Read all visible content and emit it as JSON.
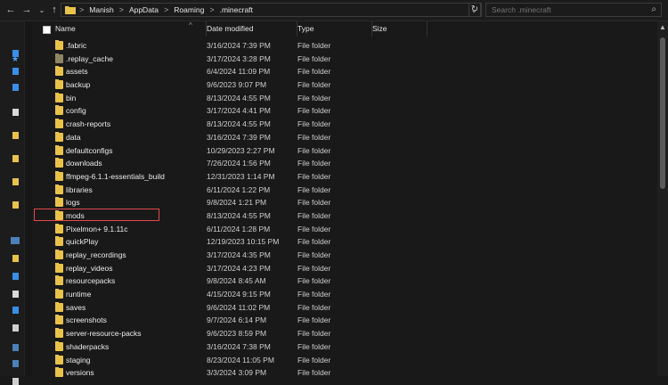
{
  "toolbar": {
    "back_icon": "back-arrow-icon",
    "forward_icon": "forward-arrow-icon",
    "recent_icon": "chevron-down-icon",
    "up_icon": "up-arrow-icon",
    "refresh_icon": "refresh-icon"
  },
  "address_bar": {
    "crumbs": [
      "Manish",
      "AppData",
      "Roaming",
      ".minecraft"
    ],
    "separator": ">"
  },
  "search": {
    "placeholder": "Search .minecraft"
  },
  "columns": {
    "name": "Name",
    "date_modified": "Date modified",
    "type": "Type",
    "size": "Size"
  },
  "files": [
    {
      "name": ".fabric",
      "date": "3/16/2024 7:39 PM",
      "type": "File folder",
      "dim": false
    },
    {
      "name": ".replay_cache",
      "date": "3/17/2024 3:28 PM",
      "type": "File folder",
      "dim": true
    },
    {
      "name": "assets",
      "date": "6/4/2024 11:09 PM",
      "type": "File folder",
      "dim": false
    },
    {
      "name": "backup",
      "date": "9/6/2023 9:07 PM",
      "type": "File folder",
      "dim": false
    },
    {
      "name": "bin",
      "date": "8/13/2024 4:55 PM",
      "type": "File folder",
      "dim": false
    },
    {
      "name": "config",
      "date": "3/17/2024 4:41 PM",
      "type": "File folder",
      "dim": false
    },
    {
      "name": "crash-reports",
      "date": "8/13/2024 4:55 PM",
      "type": "File folder",
      "dim": false
    },
    {
      "name": "data",
      "date": "3/16/2024 7:39 PM",
      "type": "File folder",
      "dim": false
    },
    {
      "name": "defaultconfigs",
      "date": "10/29/2023 2:27 PM",
      "type": "File folder",
      "dim": false
    },
    {
      "name": "downloads",
      "date": "7/26/2024 1:56 PM",
      "type": "File folder",
      "dim": false
    },
    {
      "name": "ffmpeg-6.1.1-essentials_build",
      "date": "12/31/2023 1:14 PM",
      "type": "File folder",
      "dim": false
    },
    {
      "name": "libraries",
      "date": "6/11/2024 1:22 PM",
      "type": "File folder",
      "dim": false
    },
    {
      "name": "logs",
      "date": "9/8/2024 1:21 PM",
      "type": "File folder",
      "dim": false
    },
    {
      "name": "mods",
      "date": "8/13/2024 4:55 PM",
      "type": "File folder",
      "dim": false,
      "highlight": true
    },
    {
      "name": "Pixelmon+ 9.1.11c",
      "date": "6/11/2024 1:28 PM",
      "type": "File folder",
      "dim": false
    },
    {
      "name": "quickPlay",
      "date": "12/19/2023 10:15 PM",
      "type": "File folder",
      "dim": false
    },
    {
      "name": "replay_recordings",
      "date": "3/17/2024 4:35 PM",
      "type": "File folder",
      "dim": false
    },
    {
      "name": "replay_videos",
      "date": "3/17/2024 4:23 PM",
      "type": "File folder",
      "dim": false
    },
    {
      "name": "resourcepacks",
      "date": "9/8/2024 8:45 AM",
      "type": "File folder",
      "dim": false
    },
    {
      "name": "runtime",
      "date": "4/15/2024 9:15 PM",
      "type": "File folder",
      "dim": false
    },
    {
      "name": "saves",
      "date": "9/6/2024 11:02 PM",
      "type": "File folder",
      "dim": false
    },
    {
      "name": "screenshots",
      "date": "9/7/2024 6:14 PM",
      "type": "File folder",
      "dim": false
    },
    {
      "name": "server-resource-packs",
      "date": "9/6/2023 8:59 PM",
      "type": "File folder",
      "dim": false
    },
    {
      "name": "shaderpacks",
      "date": "3/16/2024 7:38 PM",
      "type": "File folder",
      "dim": false
    },
    {
      "name": "staging",
      "date": "8/23/2024 11:05 PM",
      "type": "File folder",
      "dim": false
    },
    {
      "name": "versions",
      "date": "3/3/2024 3:09 PM",
      "type": "File folder",
      "dim": false
    }
  ],
  "colors": {
    "background": "#191919",
    "folder": "#e9c24a",
    "highlight_box": "#e24a4a",
    "pin_accent": "#4aa3ff"
  }
}
